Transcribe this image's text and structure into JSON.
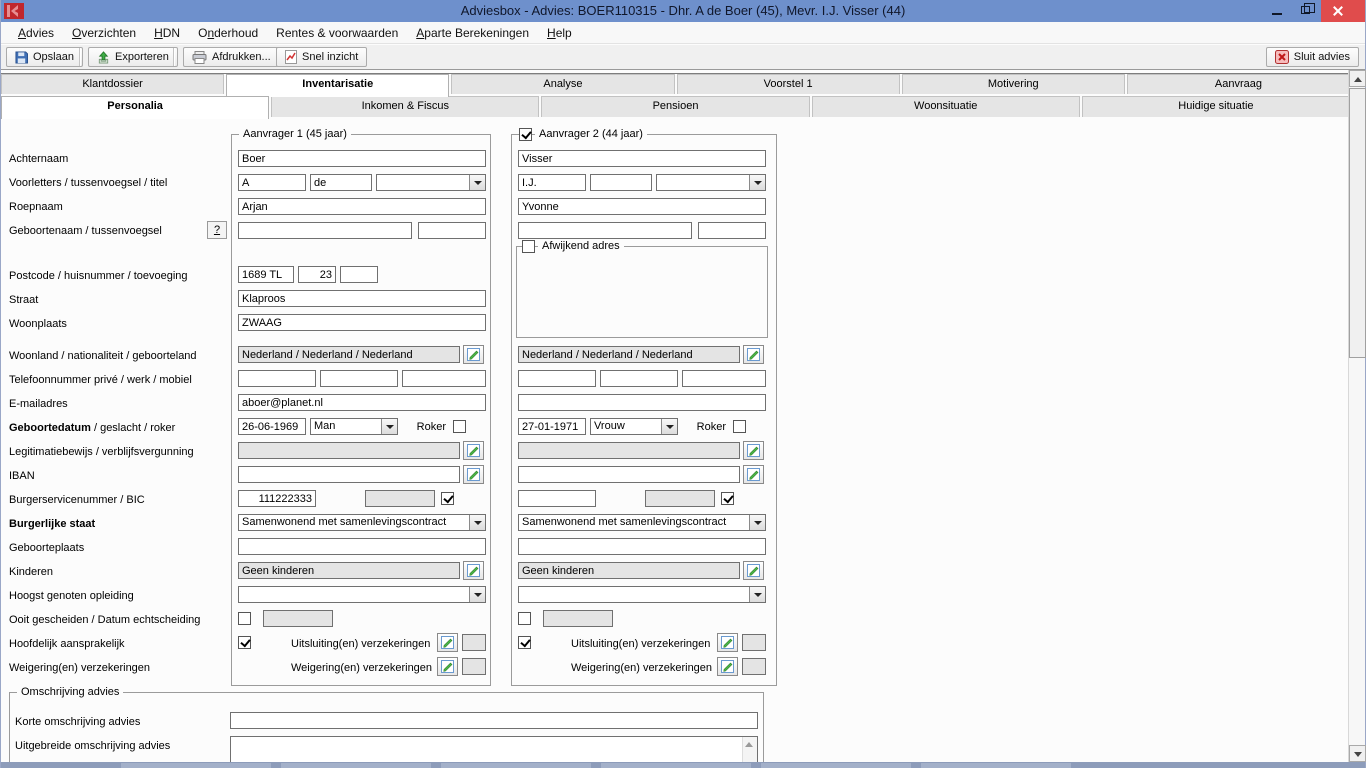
{
  "titlebar": {
    "title": "Adviesbox - Advies: BOER110315 - Dhr. A de Boer (45), Mevr. I.J. Visser (44)"
  },
  "menu": {
    "items": [
      {
        "pre": "",
        "accel": "A",
        "post": "dvies"
      },
      {
        "pre": "",
        "accel": "O",
        "post": "verzichten"
      },
      {
        "pre": "",
        "accel": "H",
        "post": "DN"
      },
      {
        "pre": "O",
        "accel": "n",
        "post": "derhoud"
      },
      {
        "pre": "Rentes & voorwaarden",
        "accel": "",
        "post": ""
      },
      {
        "pre": "",
        "accel": "A",
        "post": "parte Berekeningen"
      },
      {
        "pre": "",
        "accel": "H",
        "post": "elp"
      }
    ]
  },
  "toolbar": {
    "opslaan": "Opslaan",
    "exporteren": "Exporteren",
    "afdrukken": "Afdrukken...",
    "snel_inzicht": "Snel inzicht",
    "sluit_advies": "Sluit advies"
  },
  "tabs": {
    "main": [
      "Klantdossier",
      "Inventarisatie",
      "Analyse",
      "Voorstel 1",
      "Motivering",
      "Aanvraag"
    ],
    "main_active": "Inventarisatie",
    "sub": [
      "Personalia",
      "Inkomen & Fiscus",
      "Pensioen",
      "Woonsituatie",
      "Huidige situatie"
    ],
    "sub_active": "Personalia"
  },
  "labels": {
    "achternaam": "Achternaam",
    "voorletters": "Voorletters / tussenvoegsel / titel",
    "roepnaam": "Roepnaam",
    "geboortenaam": "Geboortenaam / tussenvoegsel",
    "help": "?",
    "postcode": "Postcode / huisnummer / toevoeging",
    "straat": "Straat",
    "woonplaats": "Woonplaats",
    "woonland": "Woonland / nationaliteit / geboorteland",
    "telefoon": "Telefoonnummer privé / werk / mobiel",
    "email": "E-mailadres",
    "geboortedatum_bold": "Geboortedatum",
    "geboortedatum_rest": " / geslacht / roker",
    "legitimatie": "Legitimatiebewijs / verblijfsvergunning",
    "iban": "IBAN",
    "bsn": "Burgerservicenummer / BIC",
    "burgerlijke_staat": "Burgerlijke staat",
    "geboorteplaats": "Geboorteplaats",
    "kinderen": "Kinderen",
    "opleiding": "Hoogst genoten opleiding",
    "gescheiden": "Ooit gescheiden / Datum echtscheiding",
    "hoofdelijk": "Hoofdelijk aansprakelijk",
    "weigering": "Weigering(en) verzekeringen"
  },
  "aanvrager1": {
    "legend": "Aanvrager 1 (45 jaar)",
    "achternaam": "Boer",
    "voorletters": "A",
    "tussenvoegsel": "de",
    "titel": "",
    "roepnaam": "Arjan",
    "geboortenaam": "",
    "geboortenaam_tussenvoegsel": "",
    "postcode": "1689 TL",
    "huisnummer": "23",
    "toevoeging": "",
    "straat": "Klaproos",
    "woonplaats": "ZWAAG",
    "woonland": "Nederland / Nederland / Nederland",
    "telefoon_prive": "",
    "telefoon_werk": "",
    "telefoon_mobiel": "",
    "email": "aboer@planet.nl",
    "geboortedatum": "26-06-1969",
    "geslacht": "Man",
    "roker_label": "Roker",
    "roker_checked": false,
    "legitimatie": "",
    "iban": "",
    "bsn": "111222333",
    "bic": "",
    "bic_checked": true,
    "burgerlijke_staat": "Samenwonend met samenlevingscontract",
    "geboorteplaats": "",
    "kinderen": "Geen kinderen",
    "opleiding": "",
    "gescheiden_checked": false,
    "datum_echtscheiding": "",
    "hoofdelijk_checked": true,
    "uitsluiting_label": "Uitsluiting(en) verzekeringen",
    "weigering_label": "Weigering(en) verzekeringen"
  },
  "aanvrager2": {
    "legend": "Aanvrager 2 (44 jaar)",
    "enabled_checked": true,
    "afwijkend_adres_label": "Afwijkend adres",
    "afwijkend_adres_checked": false,
    "achternaam": "Visser",
    "voorletters": "I.J.",
    "tussenvoegsel": "",
    "titel": "",
    "roepnaam": "Yvonne",
    "geboortenaam": "",
    "geboortenaam_tussenvoegsel": "",
    "woonland": "Nederland / Nederland / Nederland",
    "telefoon_prive": "",
    "telefoon_werk": "",
    "telefoon_mobiel": "",
    "email": "",
    "geboortedatum": "27-01-1971",
    "geslacht": "Vrouw",
    "roker_label": "Roker",
    "roker_checked": false,
    "legitimatie": "",
    "iban": "",
    "bsn": "",
    "bic": "",
    "bic_checked": true,
    "burgerlijke_staat": "Samenwonend met samenlevingscontract",
    "geboorteplaats": "",
    "kinderen": "Geen kinderen",
    "opleiding": "",
    "gescheiden_checked": false,
    "datum_echtscheiding": "",
    "hoofdelijk_checked": true,
    "uitsluiting_label": "Uitsluiting(en) verzekeringen",
    "weigering_label": "Weigering(en) verzekeringen"
  },
  "omschrijving": {
    "legend": "Omschrijving advies",
    "korte_label": "Korte omschrijving advies",
    "korte_value": "",
    "uitgebreide_label": "Uitgebreide omschrijving advies",
    "uitgebreide_value": ""
  }
}
